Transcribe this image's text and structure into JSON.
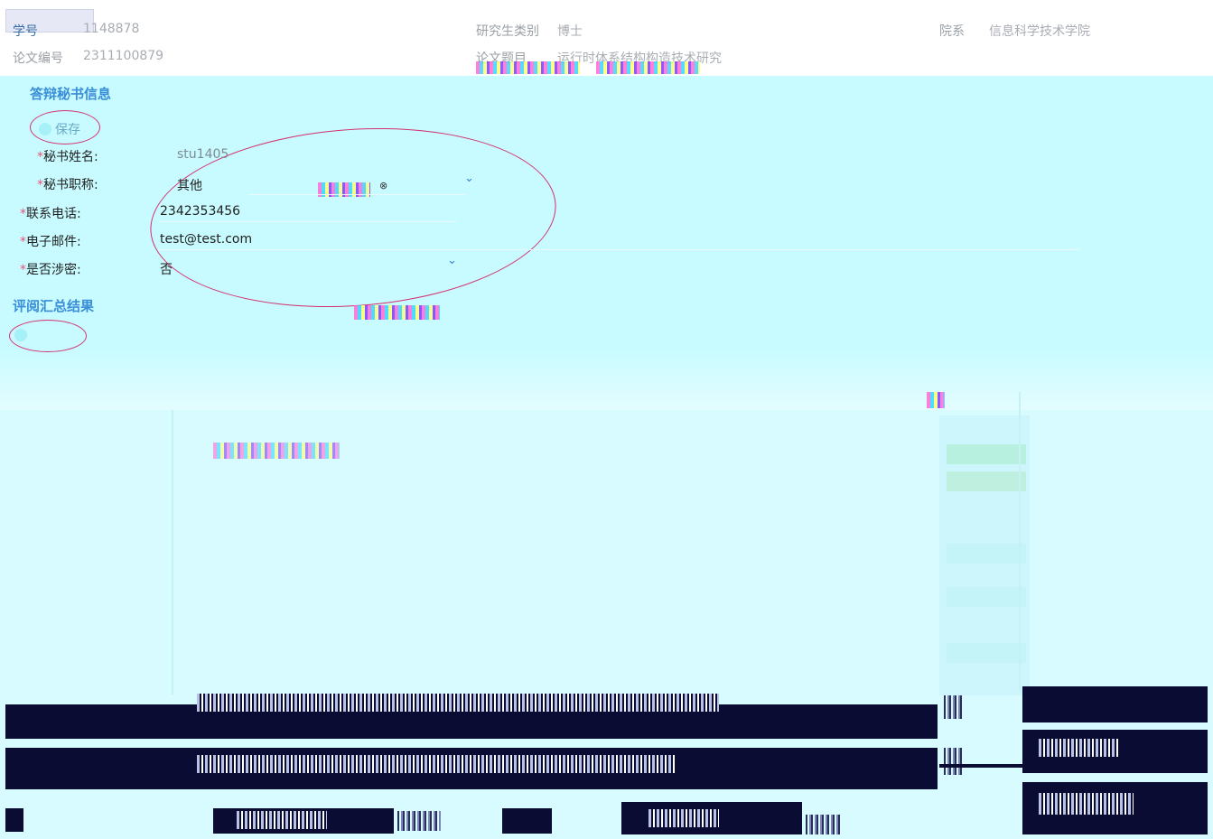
{
  "header": {
    "student_id_label": "学号",
    "student_id_value": "1148878",
    "student_type_label": "研究生类别",
    "student_type_value": "博士",
    "department_label": "院系",
    "department_value": "信息科学技术学院",
    "thesis_no_label": "论文编号",
    "thesis_no_value": "2311100879",
    "thesis_title_label": "论文题目",
    "thesis_title_value": "运行时体系结构构造技术研究"
  },
  "secretary_section": {
    "title": "答辩秘书信息",
    "save_label": "保存",
    "fields": [
      {
        "label": "秘书姓名:",
        "value": "stu1405"
      },
      {
        "label": "秘书职称:",
        "value": "其他"
      },
      {
        "label": "联系电话:",
        "value": "2342353456"
      },
      {
        "label": "电子邮件:",
        "value": "test@test.com"
      },
      {
        "label": "是否涉密:",
        "value": "否"
      }
    ]
  },
  "review_section": {
    "title": "评阅汇总结果"
  },
  "icons": {
    "save": "save-icon",
    "dropdown": "chevron-down-icon",
    "review_action": "circle-button-icon"
  },
  "colors": {
    "section_title": "#3a8fd8",
    "required_mark": "#e8557a",
    "annotation_ring": "#d5306e",
    "background": "#d8fbff"
  }
}
